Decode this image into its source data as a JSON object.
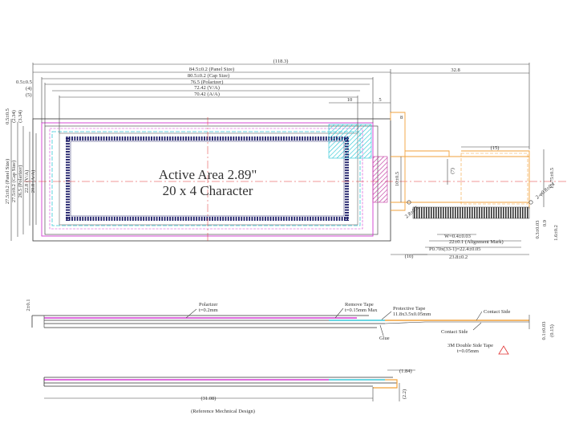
{
  "dimensions": {
    "d_118_3": "(118.3)",
    "panel_size": "84.5±0.2 (Panel Size)",
    "cap_size": "80.5±0.2 (Cap Size)",
    "polarizer": "76.5 (Polarizer)",
    "va": "72.42 (V/A)",
    "aa": "70.42 (A/A)",
    "d_0_5": "0.5±0.5",
    "d_4": "(4)",
    "d_5": "(5)",
    "d_32_8": "32.8",
    "d_10_top": "10",
    "d_5_top": "5",
    "d_8": "8",
    "d_15": "(15)",
    "d_7": "(7)",
    "d_10_left": "10±0.5",
    "d_13_75": "13.75±0.5",
    "d_0_5_bot": "0.5±0.5",
    "d_3_34": "(3.34)",
    "d_2_34": "(2.34)",
    "d_20_8": "20.8 (A/A)",
    "d_22_8": "22.8 (V/A)",
    "d_26_5": "26.5 (Polarizer)",
    "d_27_5": "27.5±0.2 (Cap Size)",
    "d_27_5b": "27.5±0.2 (Panel Size)",
    "w": "W=0.4±0.03",
    "alignment": "22±0.1 (Alignment Mark)",
    "pitch": "P0.70x(33-1)=22.4±0.05",
    "d_23_8": "23.8±0.2",
    "d_10_b": "(10)",
    "d_2_r": "2-φ0.8±0.1",
    "d_r1": "1.6±0.2",
    "d_r2": "0.9",
    "d_r3": "0.3±0.03",
    "d_2_b": "2.8±0.5",
    "d_2t": "2±0.1",
    "d_1_84": "(1.84)",
    "d_31_08": "(31.08)",
    "d_2_2": "(2.2)",
    "d_0_1": "0.1±0.03",
    "d_0_15": "(0.15)"
  },
  "active_area": {
    "line1": "Active Area 2.89\"",
    "line2": "20 x 4 Character"
  },
  "side_labels": {
    "polarizer": "Polarizer",
    "polarizer_t": "t=0.2mm",
    "remove_tape": "Remove Tape",
    "remove_tape_t": "t=0.15mm Max",
    "protective_tape": "Protective Tape",
    "protective_tape_size": "11.8x3.5x0.05mm",
    "glue": "Glue",
    "contact_side_1": "Contact Side",
    "contact_side_2": "Contact Side",
    "tape3m": "3M Double Side Tape",
    "tape3m_t": "t=0.05mm"
  },
  "caption": "(Reference Mechnical Design)",
  "colors": {
    "panel": "#333333",
    "magenta": "#d23bd2",
    "cyan": "#39c9d8",
    "navy": "#1a1a66",
    "orange": "#f2a23b",
    "red": "#e03030",
    "hatch_cyan": "#22c4d4",
    "hatch_magenta": "#c0359e"
  }
}
